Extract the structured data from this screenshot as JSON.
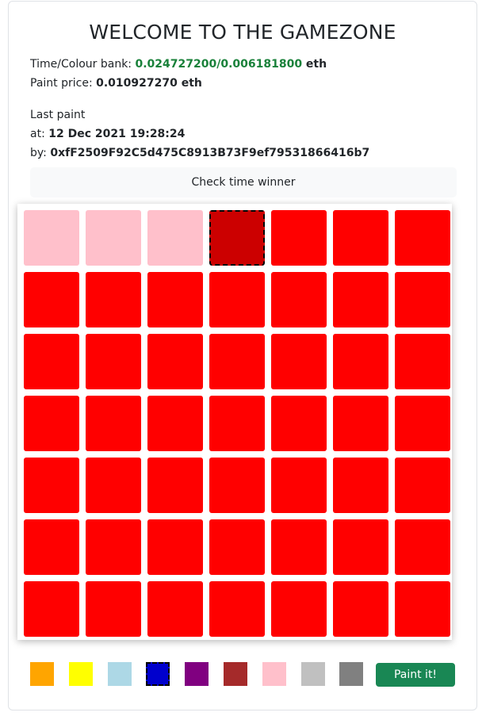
{
  "header": {
    "title": "WELCOME TO THE GAMEZONE"
  },
  "bank": {
    "label": "Time/Colour bank: ",
    "time_value": "0.024727200",
    "separator": "/",
    "colour_value": "0.006181800",
    "unit": " eth"
  },
  "price": {
    "label": "Paint price: ",
    "value": "0.010927270 eth"
  },
  "last_paint": {
    "heading": "Last paint",
    "at_label": "at: ",
    "at_value": "12 Dec 2021 19:28:24",
    "by_label": "by: ",
    "by_value": "0xfF2509F92C5d475C8913B73F9ef79531866416b7"
  },
  "check_button": {
    "label": "Check time winner"
  },
  "board": {
    "rows": 7,
    "cols": 7,
    "selected_cell": [
      0,
      3
    ],
    "cells": [
      [
        "#ffc0cb",
        "#ffc0cb",
        "#ffc0cb",
        "#cc0000",
        "#ff0000",
        "#ff0000",
        "#ff0000"
      ],
      [
        "#ff0000",
        "#ff0000",
        "#ff0000",
        "#ff0000",
        "#ff0000",
        "#ff0000",
        "#ff0000"
      ],
      [
        "#ff0000",
        "#ff0000",
        "#ff0000",
        "#ff0000",
        "#ff0000",
        "#ff0000",
        "#ff0000"
      ],
      [
        "#ff0000",
        "#ff0000",
        "#ff0000",
        "#ff0000",
        "#ff0000",
        "#ff0000",
        "#ff0000"
      ],
      [
        "#ff0000",
        "#ff0000",
        "#ff0000",
        "#ff0000",
        "#ff0000",
        "#ff0000",
        "#ff0000"
      ],
      [
        "#ff0000",
        "#ff0000",
        "#ff0000",
        "#ff0000",
        "#ff0000",
        "#ff0000",
        "#ff0000"
      ],
      [
        "#ff0000",
        "#ff0000",
        "#ff0000",
        "#ff0000",
        "#ff0000",
        "#ff0000",
        "#ff0000"
      ]
    ]
  },
  "palette": {
    "colors": [
      "#ffa500",
      "#ffff00",
      "#add8e6",
      "#0000cd",
      "#800080",
      "#a52a2a",
      "#ffc0cb",
      "#c0c0c0",
      "#808080"
    ],
    "names": [
      "orange",
      "yellow",
      "lightblue",
      "blue",
      "purple",
      "brown",
      "pink",
      "silver",
      "gray"
    ],
    "selected_index": 3
  },
  "paint_button": {
    "label": "Paint it!"
  }
}
